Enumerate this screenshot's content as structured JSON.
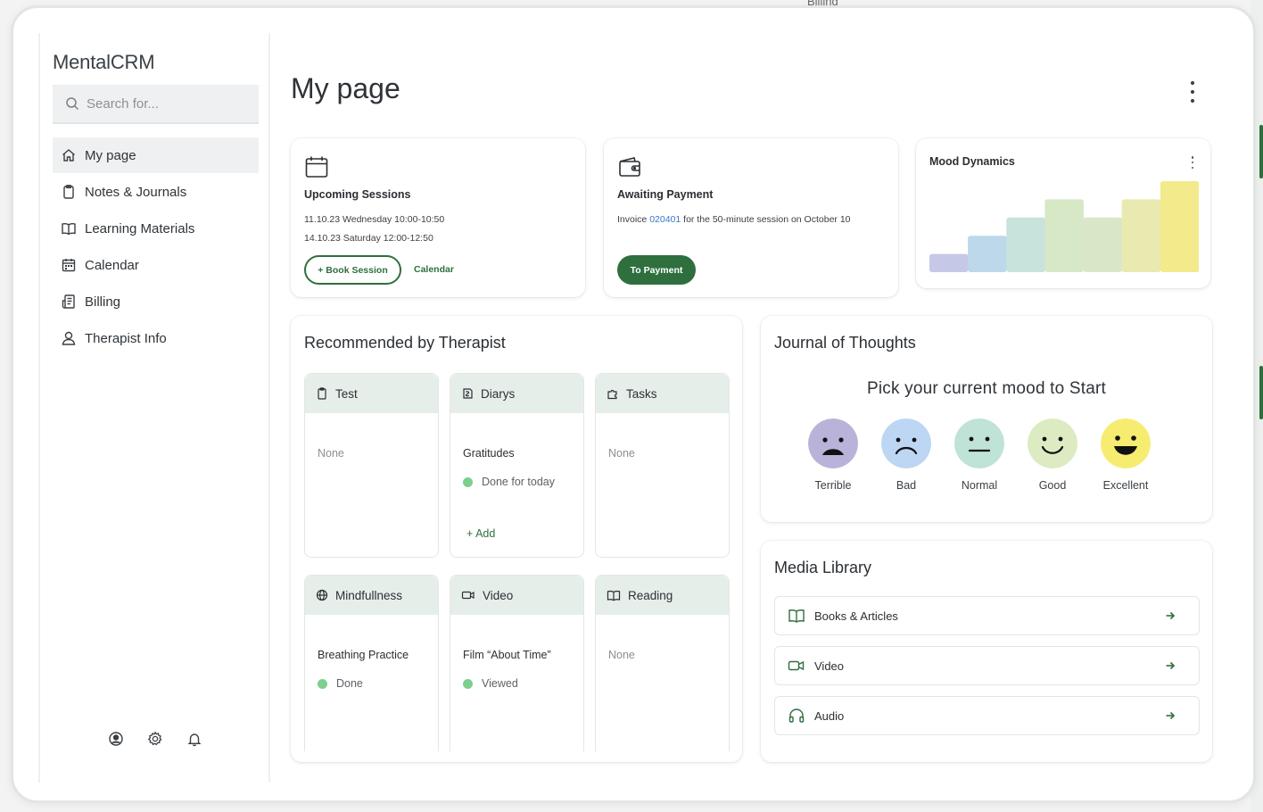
{
  "app": {
    "brand": "MentalCRM"
  },
  "search": {
    "placeholder": "Search for..."
  },
  "nav": {
    "items": [
      {
        "label": "My page",
        "icon": "home-icon"
      },
      {
        "label": "Notes & Journals",
        "icon": "clipboard-icon"
      },
      {
        "label": "Learning Materials",
        "icon": "open-book-icon"
      },
      {
        "label": "Calendar",
        "icon": "calendar-icon"
      },
      {
        "label": "Billing",
        "icon": "receipt-icon"
      },
      {
        "label": "Therapist Info",
        "icon": "person-icon"
      }
    ]
  },
  "page": {
    "title": "My page"
  },
  "background": {
    "peek_label": "Billing"
  },
  "upcoming": {
    "title": "Upcoming Sessions",
    "sessions": [
      "11.10.23 Wednesday 10:00-10:50",
      "14.10.23 Saturday 12:00-12:50"
    ],
    "book_label": "+ Book Session",
    "calendar_label": "Calendar"
  },
  "payment": {
    "title": "Awaiting Payment",
    "text_before": "Invoice ",
    "invoice_number": "020401",
    "text_after": " for the 50-minute session on October 10",
    "button_label": "To Payment"
  },
  "mood_dynamics": {
    "title": "Mood Dynamics",
    "levels": [
      1,
      2,
      3,
      4,
      3,
      4,
      5
    ],
    "max_level": 5,
    "colors": [
      "#c5c8e6",
      "#bcd8ea",
      "#c8e2dc",
      "#d6e8c6",
      "#d9e6c8",
      "#e8eab0",
      "#f3ea8c"
    ]
  },
  "recommended": {
    "title": "Recommended by Therapist",
    "tiles": [
      {
        "title": "Test",
        "icon": "clipboard-icon",
        "item": "None",
        "status": "",
        "add": ""
      },
      {
        "title": "Diarys",
        "icon": "diary-icon",
        "item": "Gratitudes",
        "status": "Done for today",
        "add": "+ Add"
      },
      {
        "title": "Tasks",
        "icon": "puzzle-icon",
        "item": "None",
        "status": "",
        "add": ""
      },
      {
        "title": "Mindfullness",
        "icon": "globe-icon",
        "item": "Breathing Practice",
        "status": "Done",
        "add": ""
      },
      {
        "title": "Video",
        "icon": "video-icon",
        "item": "Film “About Time”",
        "status": "Viewed",
        "add": ""
      },
      {
        "title": "Reading",
        "icon": "open-book-icon",
        "item": "None",
        "status": "",
        "add": ""
      }
    ],
    "status_color": "#7ccf8e"
  },
  "journal": {
    "title": "Journal of Thoughts",
    "prompt": "Pick your current mood to Start",
    "moods": [
      {
        "label": "Terrible",
        "color": "#b9b3d9"
      },
      {
        "label": "Bad",
        "color": "#bcd6f3"
      },
      {
        "label": "Normal",
        "color": "#bfe3d6"
      },
      {
        "label": "Good",
        "color": "#dcebc2"
      },
      {
        "label": "Excellent",
        "color": "#f6ec70"
      }
    ]
  },
  "media": {
    "title": "Media Library",
    "items": [
      {
        "label": "Books & Articles",
        "icon": "open-book-icon"
      },
      {
        "label": "Video",
        "icon": "video-icon"
      },
      {
        "label": "Audio",
        "icon": "headphones-icon"
      }
    ]
  },
  "colors": {
    "accent": "#2f6f3e",
    "link": "#3a78c9",
    "tile_header": "#e6eeea"
  }
}
